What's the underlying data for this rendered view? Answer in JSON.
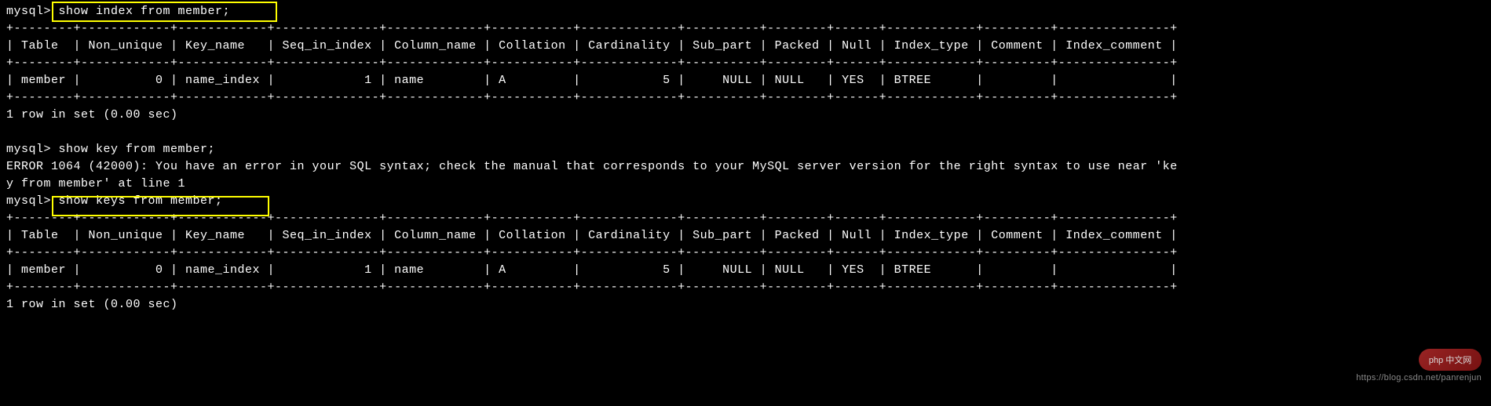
{
  "prompt": "mysql>",
  "commands": {
    "show_index": "show index from member;",
    "show_key": "show key from member;",
    "show_keys": "show keys from member;"
  },
  "table": {
    "headers": [
      "Table",
      "Non_unique",
      "Key_name",
      "Seq_in_index",
      "Column_name",
      "Collation",
      "Cardinality",
      "Sub_part",
      "Packed",
      "Null",
      "Index_type",
      "Comment",
      "Index_comment"
    ],
    "rows": [
      {
        "Table": "member",
        "Non_unique": "0",
        "Key_name": "name_index",
        "Seq_in_index": "1",
        "Column_name": "name",
        "Collation": "A",
        "Cardinality": "5",
        "Sub_part": "NULL",
        "Packed": "NULL",
        "Null": "YES",
        "Index_type": "BTREE",
        "Comment": "",
        "Index_comment": ""
      }
    ]
  },
  "row_summary": "1 row in set (0.00 sec)",
  "error": {
    "line1": "ERROR 1064 (42000): You have an error in your SQL syntax; check the manual that corresponds to your MySQL server version for the right syntax to use near 'ke",
    "line2": "y from member' at line 1"
  },
  "watermark": {
    "logo": "php 中文网",
    "url": "https://blog.csdn.net/panrenjun"
  },
  "border_line": "+--------+------------+------------+--------------+-------------+-----------+-------------+----------+--------+------+------------+---------+---------------+",
  "header_line": "| Table  | Non_unique | Key_name   | Seq_in_index | Column_name | Collation | Cardinality | Sub_part | Packed | Null | Index_type | Comment | Index_comment |",
  "data_line": "| member |          0 | name_index |            1 | name        | A         |           5 |     NULL | NULL   | YES  | BTREE      |         |               |"
}
